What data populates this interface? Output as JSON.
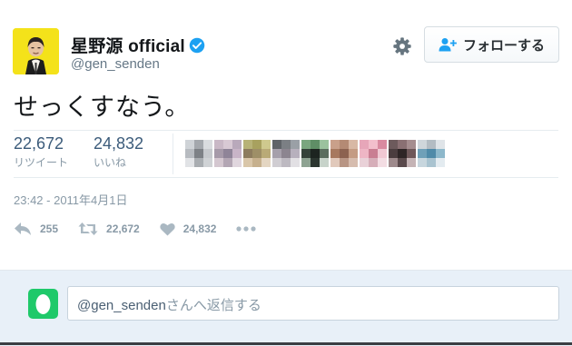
{
  "tweet": {
    "user": {
      "display_name": "星野源 official",
      "handle": "@gen_senden",
      "verified": true,
      "verified_icon": "verified-badge-icon"
    },
    "settings_icon": "gear-icon",
    "follow_button": {
      "label": "フォローする",
      "icon": "follow-person-plus-icon"
    },
    "text": "せっくすなう。",
    "stats": {
      "retweets": {
        "count": "22,672",
        "label": "リツイート"
      },
      "likes": {
        "count": "24,832",
        "label": "いいね"
      }
    },
    "liker_avatar_count": 9,
    "timestamp": "23:42 - 2011年4月1日",
    "actions": {
      "reply": {
        "icon": "reply-icon",
        "count": "255"
      },
      "retweet": {
        "icon": "retweet-icon",
        "count": "22,672"
      },
      "like": {
        "icon": "heart-icon",
        "count": "24,832"
      },
      "more": {
        "icon": "more-dots-icon"
      }
    }
  },
  "reply_box": {
    "mention": "@gen_senden",
    "placeholder_suffix": "さんへ返信する"
  },
  "colors": {
    "link_gray": "#3b5b7a",
    "verified_blue": "#1da1f2",
    "reply_bg": "#e8f0f8",
    "reply_avatar": "#1fc96a"
  }
}
